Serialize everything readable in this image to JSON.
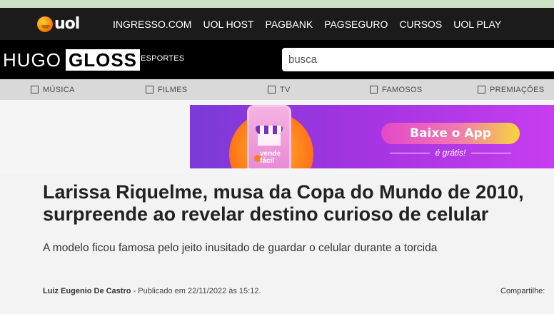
{
  "uol_bar": {
    "logo_text": "uol",
    "links": [
      "INGRESSO.COM",
      "UOL HOST",
      "PAGBANK",
      "PAGSEGURO",
      "CURSOS",
      "UOL PLAY"
    ]
  },
  "site": {
    "logo_part1": "HUGO",
    "logo_part2": "GLOSS",
    "section_link": "ESPORTES",
    "search_placeholder": "busca"
  },
  "categories": [
    "MÚSICA",
    "FILMES",
    "TV",
    "FAMOSOS",
    "PREMIAÇÕES"
  ],
  "ad": {
    "brand": "vende fácil",
    "button": "Baixe o App",
    "subtext": "é grátis!"
  },
  "article": {
    "headline": "Larissa Riquelme, musa da Copa do Mundo de 2010, surpreende ao revelar destino curioso de celular",
    "subhead": "A modelo ficou famosa pelo jeito inusitado de guardar o celular durante a torcida",
    "author": "Luiz Eugenio De Castro",
    "published": " - Publicado em 22/11/2022 às 15:12.",
    "share_label": "Compartilhe:"
  },
  "colors": {
    "top_strip": "#cde3c6",
    "uol_bar": "#1b1b1b",
    "site_bar": "#000000",
    "category_bar": "#d9d9d9",
    "ad_purple": "#a233e0"
  }
}
